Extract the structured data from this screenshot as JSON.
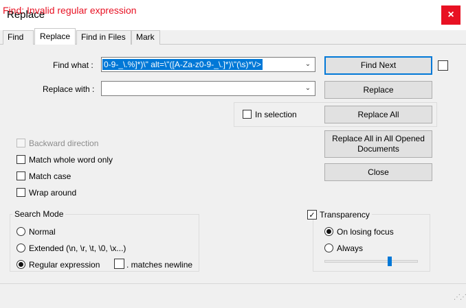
{
  "window": {
    "title": "Replace",
    "close_glyph": "×"
  },
  "tabs": [
    {
      "label": "Find"
    },
    {
      "label": "Replace"
    },
    {
      "label": "Find in Files"
    },
    {
      "label": "Mark"
    }
  ],
  "find": {
    "label": "Find what :",
    "value": "0-9-_\\.%]*)\\\" alt=\\\"([A-Za-z0-9-_\\.]*)\\\"(\\s)*\\/>"
  },
  "replace": {
    "label": "Replace with :",
    "value": ""
  },
  "in_selection": {
    "label": "In selection",
    "checked": false
  },
  "options": {
    "backward": {
      "label": "Backward direction",
      "checked": false,
      "disabled": true
    },
    "whole_word": {
      "label": "Match whole word only",
      "checked": false
    },
    "match_case": {
      "label": "Match case",
      "checked": false
    },
    "wrap": {
      "label": "Wrap around",
      "checked": false
    }
  },
  "search_mode": {
    "title": "Search Mode",
    "normal": "Normal",
    "extended": "Extended (\\n, \\r, \\t, \\0, \\x...)",
    "regex": "Regular expression",
    "newline": ". matches newline",
    "selected": "regex"
  },
  "transparency": {
    "label": "Transparency",
    "checked": true,
    "on_losing_focus": "On losing focus",
    "always": "Always",
    "selected": "on_losing_focus",
    "level": 0.71
  },
  "buttons": {
    "find_next": "Find Next",
    "replace": "Replace",
    "replace_all": "Replace All",
    "replace_all_opened": "Replace All in All Opened Documents",
    "close": "Close"
  },
  "status": {
    "text": "Find: Invalid regular expression",
    "color": "#e81123"
  },
  "colors": {
    "accent": "#0078d7",
    "close_red": "#e81123"
  },
  "icons": {
    "checkmark": "✓",
    "dropdown": "⌄"
  }
}
